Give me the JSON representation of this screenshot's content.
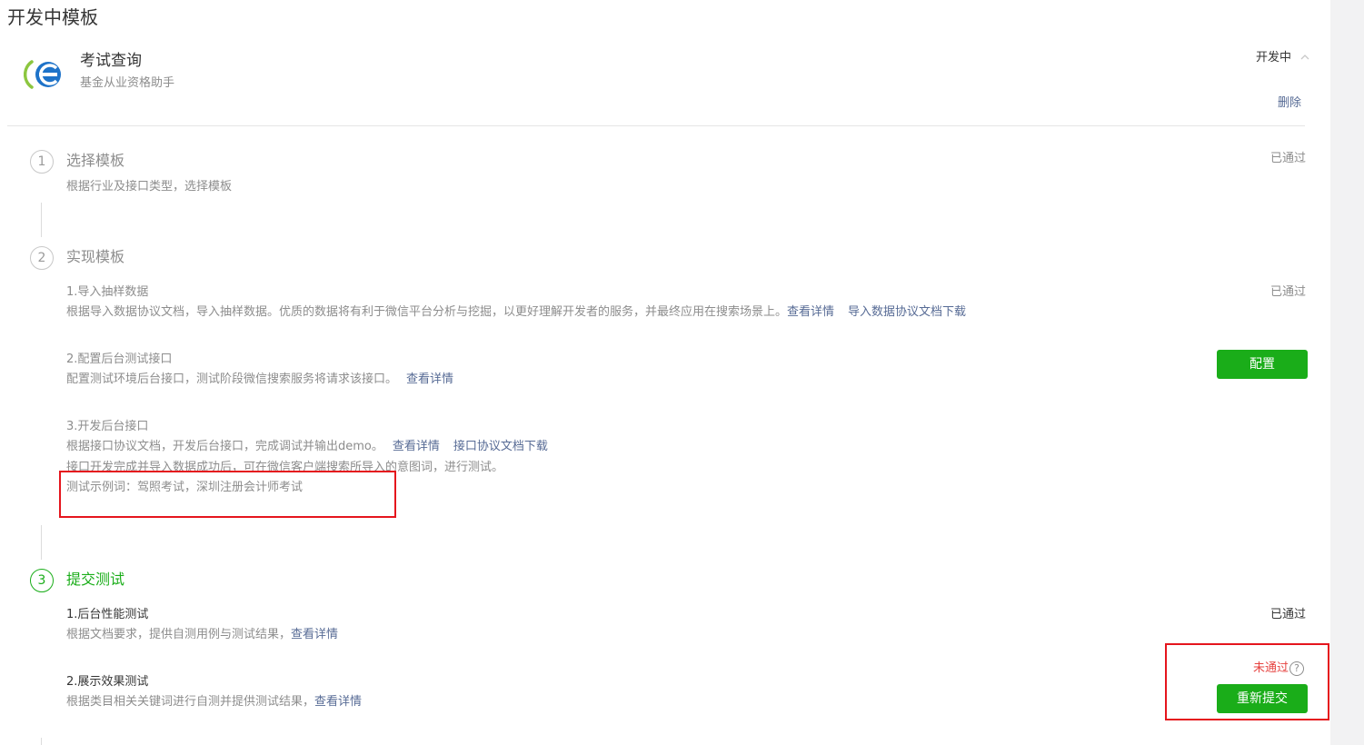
{
  "page": {
    "title": "开发中模板"
  },
  "template": {
    "name": "考试查询",
    "subtitle": "基金从业资格助手",
    "status": "开发中",
    "delete_label": "删除"
  },
  "steps": [
    {
      "number": "1",
      "title": "选择模板",
      "description": "根据行业及接口类型，选择模板",
      "status": "已通过"
    },
    {
      "number": "2",
      "title": "实现模板",
      "items": [
        {
          "title": "1.导入抽样数据",
          "description": "根据导入数据协议文档，导入抽样数据。优质的数据将有利于微信平台分析与挖掘，以更好理解开发者的服务，并最终应用在搜索场景上。",
          "link1": "查看详情",
          "link2": "导入数据协议文档下载",
          "status": "已通过"
        },
        {
          "title": "2.配置后台测试接口",
          "description": "配置测试环境后台接口，测试阶段微信搜索服务将请求该接口。",
          "link1": "查看详情",
          "button": "配置"
        },
        {
          "title": "3.开发后台接口",
          "description": "根据接口协议文档，开发后台接口，完成调试并输出demo。",
          "link1": "查看详情",
          "link2": "接口协议文档下载",
          "description2": "接口开发完成并导入数据成功后，可在微信客户端搜索所导入的意图词，进行测试。",
          "example": "测试示例词：驾照考试，深圳注册会计师考试"
        }
      ]
    },
    {
      "number": "3",
      "title": "提交测试",
      "items": [
        {
          "title": "1.后台性能测试",
          "description": "根据文档要求，提供自测用例与测试结果，",
          "link1": "查看详情",
          "status": "已通过"
        },
        {
          "title": "2.展示效果测试",
          "description": "根据类目相关关键词进行自测并提供测试结果，",
          "link1": "查看详情",
          "status": "未通过",
          "help": "?",
          "button": "重新提交"
        }
      ]
    }
  ],
  "colors": {
    "accent": "#1aad19",
    "link": "#576b95",
    "fail": "#e64340",
    "highlight_box": "#e5151d"
  }
}
